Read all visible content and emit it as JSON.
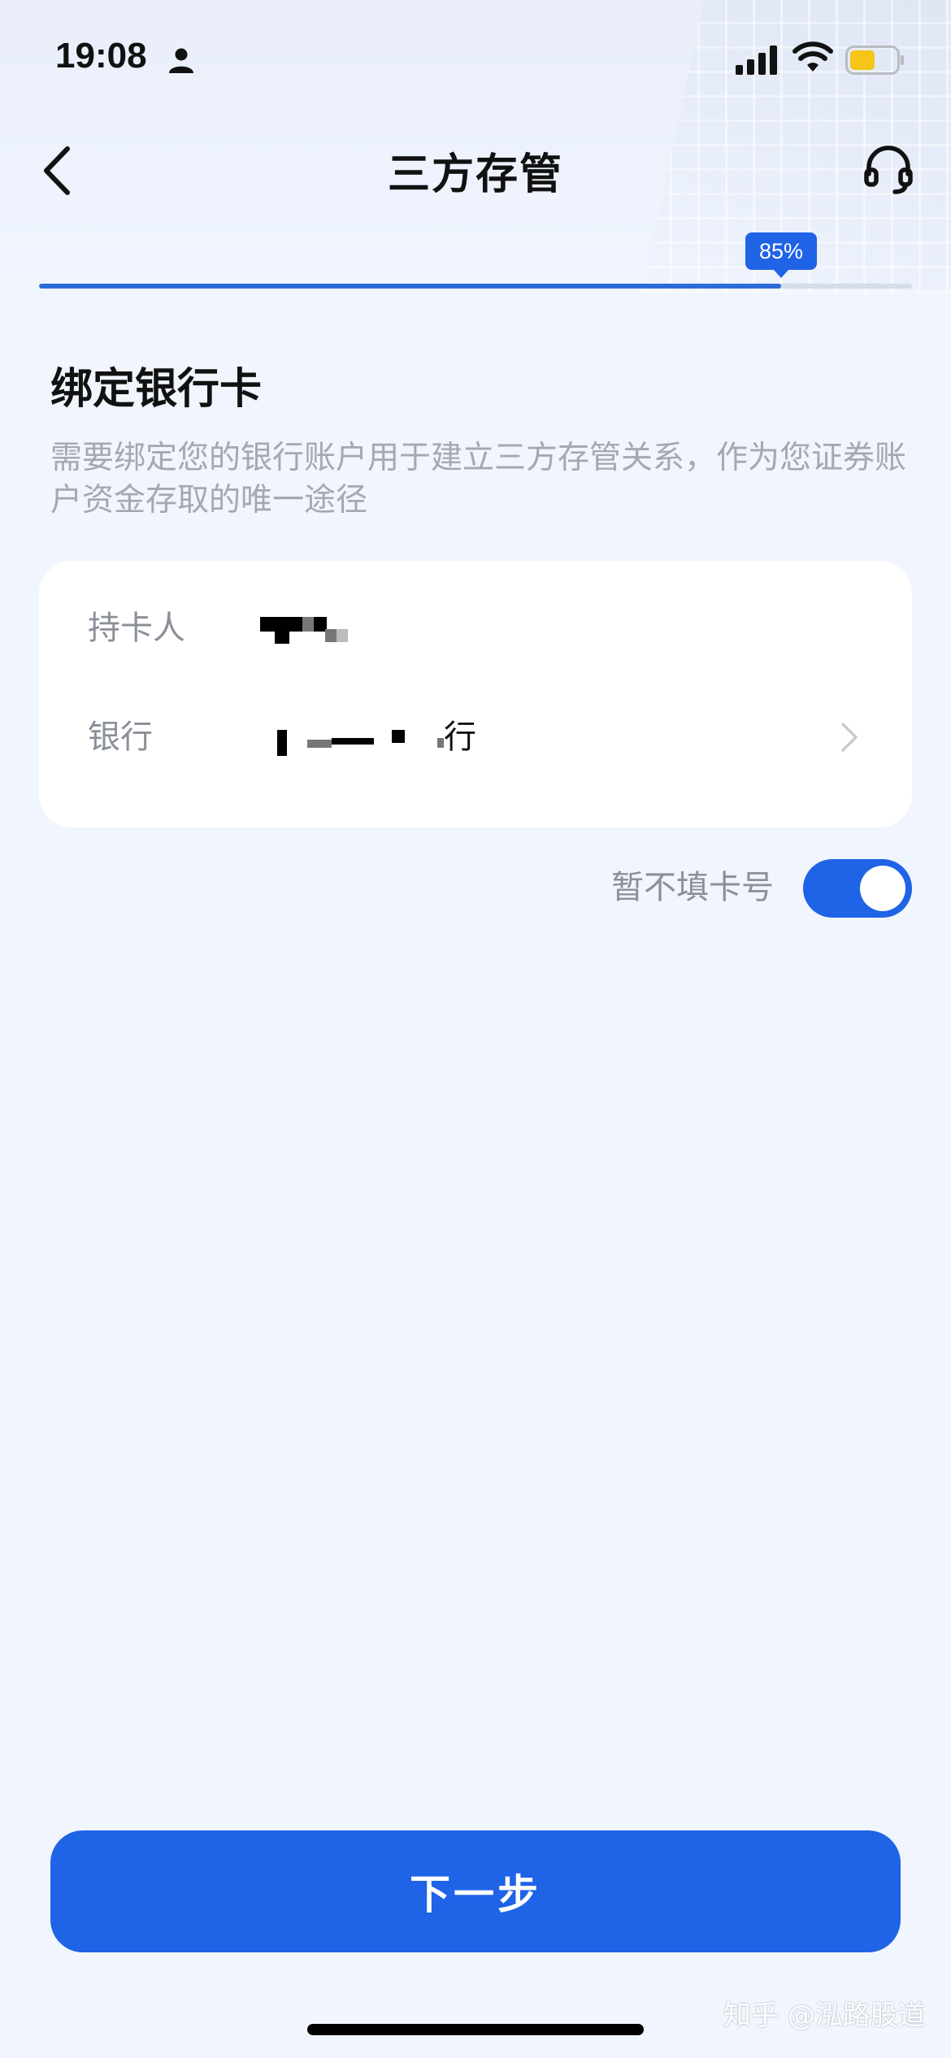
{
  "status_bar": {
    "time": "19:08",
    "icons": [
      "person-icon",
      "signal-icon",
      "wifi-icon",
      "battery-icon"
    ],
    "battery_color": "#f5c518"
  },
  "nav": {
    "title": "三方存管",
    "back_icon": "chevron-left-icon",
    "support_icon": "headset-icon"
  },
  "progress": {
    "percent": 85,
    "label": "85%",
    "fill_color": "#2e6bd8"
  },
  "section": {
    "title": "绑定银行卡",
    "description": "需要绑定您的银行账户用于建立三方存管关系，作为您证券账户资金存取的唯一途径"
  },
  "card": {
    "rows": [
      {
        "label": "持卡人",
        "value": ""
      },
      {
        "label": "银行",
        "value": "行"
      }
    ]
  },
  "toggle": {
    "label": "暂不填卡号",
    "on": true,
    "color": "#1f63e6"
  },
  "footer": {
    "next_label": "下一步",
    "watermark": "知乎 @泓路股道"
  },
  "colors": {
    "accent": "#1f63e6",
    "background": "#f0f5fe"
  }
}
